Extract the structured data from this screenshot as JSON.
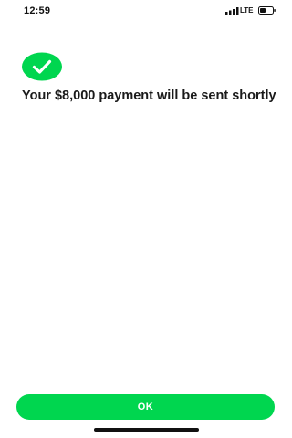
{
  "status_bar": {
    "time": "12:59",
    "network": "LTE",
    "signal_icon": "signal-bars-icon",
    "battery_icon": "battery-icon"
  },
  "success": {
    "icon": "check-circle-icon",
    "icon_color": "#00d64f",
    "message": "Your $8,000 payment will be sent shortly"
  },
  "footer": {
    "ok_label": "OK",
    "button_color": "#00d64f"
  }
}
